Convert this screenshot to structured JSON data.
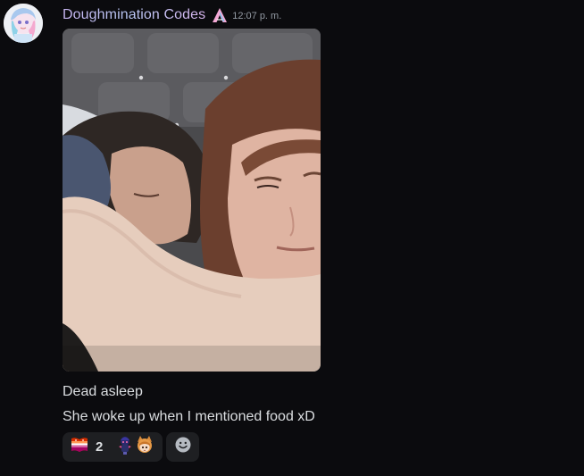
{
  "message": {
    "author": "Doughmination Codes",
    "role_icon": "pink-a-badge-icon",
    "timestamp": "12:07 p. m.",
    "attachment": "photo-attachment",
    "lines": [
      "Dead asleep",
      "She woke up when I mentioned food xD"
    ],
    "reactions": {
      "items": [
        {
          "emoji": "lesbian-flag-emoji",
          "count": "2"
        },
        {
          "emoji": "character-sticker-emoji"
        },
        {
          "emoji": "anime-fox-girl-emoji"
        }
      ],
      "add_reaction_icon": "add-reaction-icon"
    }
  },
  "colors": {
    "background": "#0b0b0e",
    "text": "#dbdee1",
    "timestamp": "#949ba4",
    "reaction_bg": "#1e1f22",
    "username_gradient_start": "#c9b6f3",
    "username_gradient_end": "#d7b5ef"
  }
}
